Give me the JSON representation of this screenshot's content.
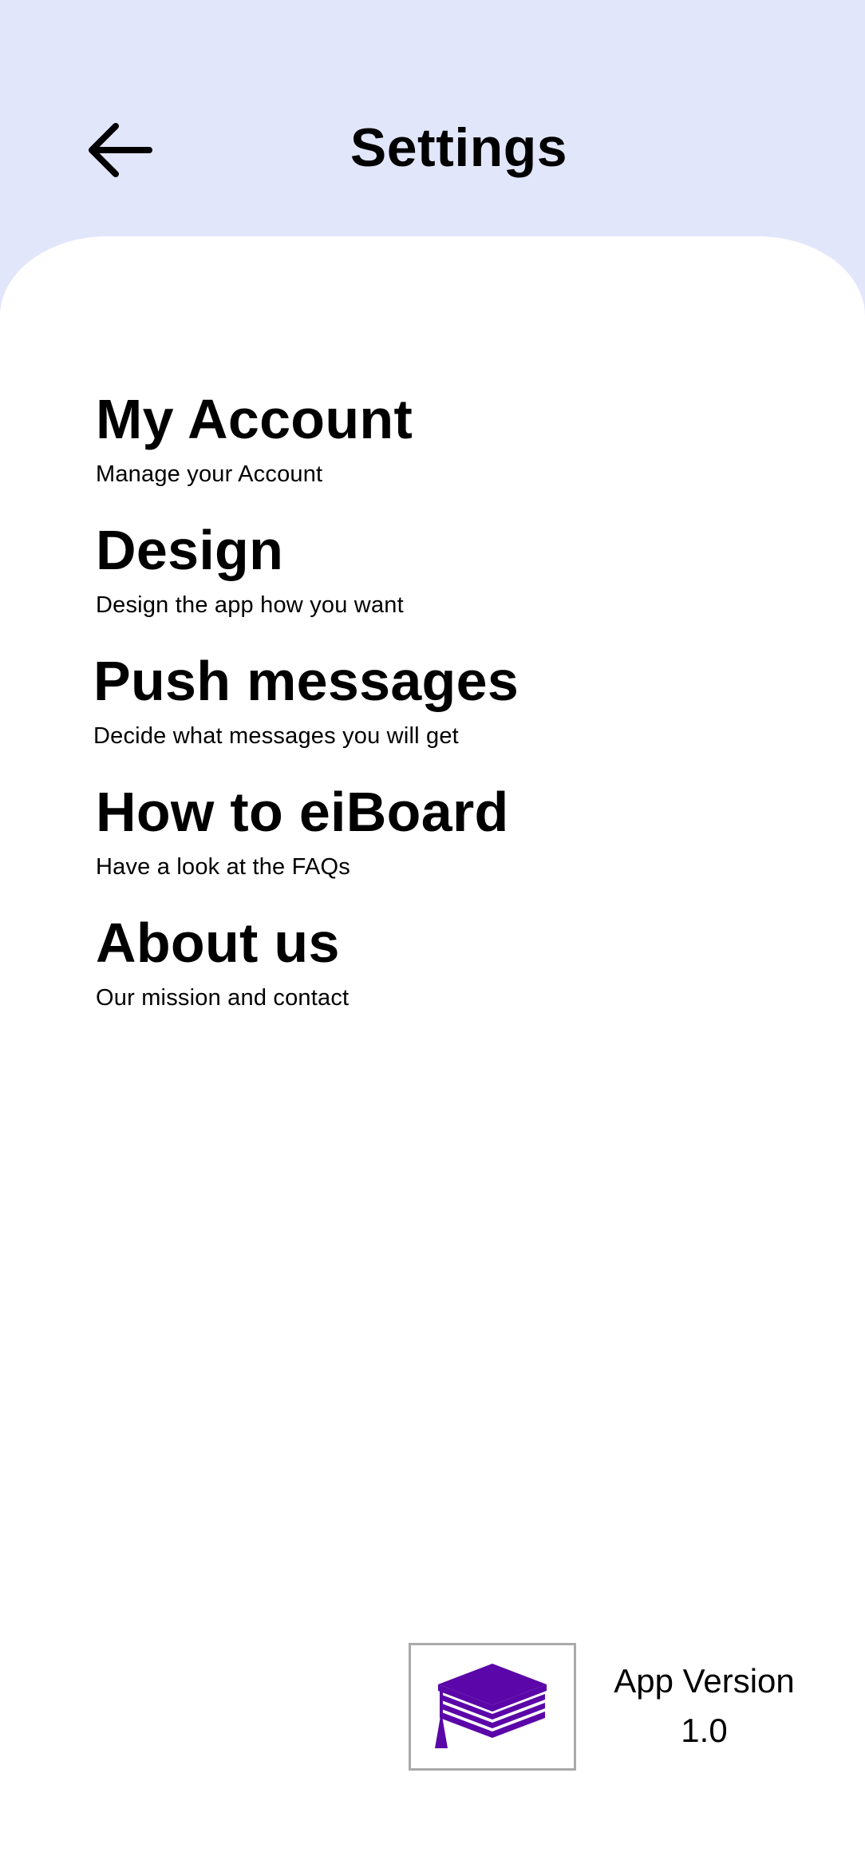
{
  "header": {
    "title": "Settings",
    "background_color": "#e2e6fb",
    "back_icon": "arrow-left-icon"
  },
  "settings": [
    {
      "title": "My Account",
      "subtitle": "Manage your Account"
    },
    {
      "title": "Design",
      "subtitle": "Design the app how you want"
    },
    {
      "title": "Push messages",
      "subtitle": "Decide what messages you will get"
    },
    {
      "title": "How to eiBoard",
      "subtitle": "Have a look at the FAQs"
    },
    {
      "title": "About us",
      "subtitle": "Our mission and contact"
    }
  ],
  "footer": {
    "logo_icon": "graduation-cap-books-icon",
    "logo_color": "#5b06a8",
    "version_label": "App Version",
    "version_number": "1.0"
  }
}
